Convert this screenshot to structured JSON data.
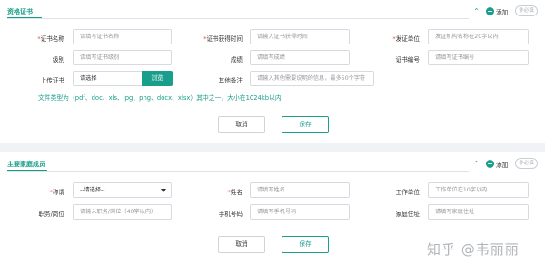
{
  "qualification": {
    "title": "资格证书",
    "add_label": "添加",
    "required_label": "非必填",
    "row1": {
      "name_label": "证书名称",
      "name_placeholder": "请填写证书名称",
      "date_label": "证书获得时间",
      "date_placeholder": "请输入证书获得时间",
      "issuer_label": "发证单位",
      "issuer_placeholder": "发证机构名称在20字以内"
    },
    "row2": {
      "level_label": "级别",
      "level_placeholder": "请填写证书级别",
      "score_label": "成绩",
      "score_placeholder": "请填写成绩",
      "number_label": "证书编号",
      "number_placeholder": "请填写证书编号"
    },
    "row3": {
      "upload_label": "上传证书",
      "upload_value": "请选择",
      "browse_label": "浏览",
      "remark_label": "其他备注",
      "remark_placeholder": "请输入其他需要说明的信息，最多50个字符"
    },
    "hint": "文件类型为（pdf、doc、xls、jpg、png、docx、xlsx）其中之一，大小在1024kb以内",
    "cancel_label": "取消",
    "save_label": "保存"
  },
  "family": {
    "title": "主要家庭成员",
    "add_label": "添加",
    "required_label": "非必填",
    "row1": {
      "relation_label": "称谓",
      "relation_value": "--请选择--",
      "name_label": "姓名",
      "name_placeholder": "请填写姓名",
      "work_label": "工作单位",
      "work_placeholder": "工作单位在10字以内"
    },
    "row2": {
      "position_label": "职务/岗位",
      "position_placeholder": "请输入职务/岗位（40字以内）",
      "phone_label": "手机号码",
      "phone_placeholder": "请填写手机号码",
      "address_label": "家庭住址",
      "address_placeholder": "请填写家庭住址"
    },
    "cancel_label": "取消",
    "save_label": "保存"
  },
  "watermark": "知乎 @韦丽丽",
  "colors": {
    "accent": "#1a9e8c",
    "required": "#e54d42",
    "border": "#d7dbe0"
  }
}
